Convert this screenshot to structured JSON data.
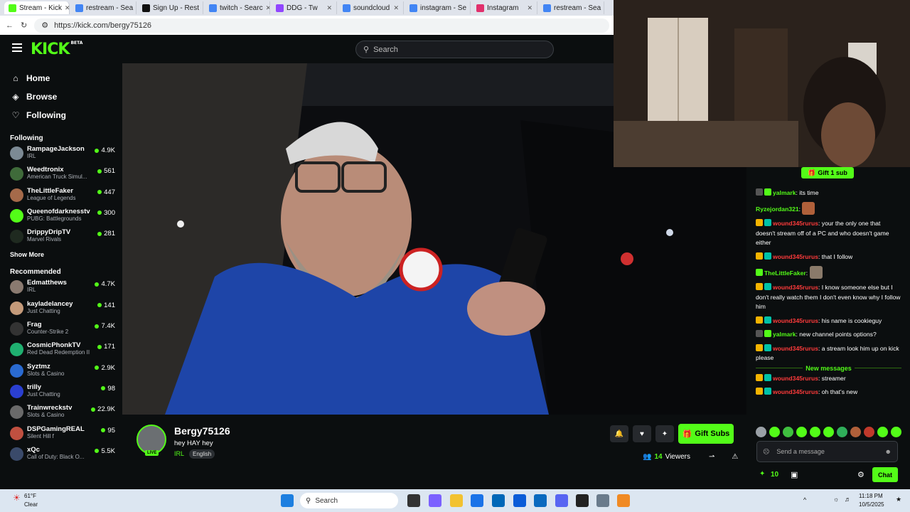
{
  "browser": {
    "tabs": [
      {
        "label": "Stream - Kick",
        "color": "#53fc18"
      },
      {
        "label": "restream - Sea",
        "color": "#4285f4"
      },
      {
        "label": "Sign Up - Rest",
        "color": "#111111"
      },
      {
        "label": "twitch - Searc",
        "color": "#4285f4"
      },
      {
        "label": "DDG - Tw",
        "color": "#9146ff"
      },
      {
        "label": "soundcloud",
        "color": "#4285f4"
      },
      {
        "label": "instagram - Se",
        "color": "#4285f4"
      },
      {
        "label": "Instagram",
        "color": "#e1306c"
      },
      {
        "label": "restream - Sea",
        "color": "#4285f4"
      }
    ],
    "url": "https://kick.com/bergy75126"
  },
  "header": {
    "logo": "KICK",
    "logo_beta": "BETA",
    "search_placeholder": "Search"
  },
  "sidebar": {
    "nav": [
      {
        "label": "Home",
        "icon": "⌂"
      },
      {
        "label": "Browse",
        "icon": "◈"
      },
      {
        "label": "Following",
        "icon": "♡"
      }
    ],
    "following_title": "Following",
    "following": [
      {
        "name": "RampageJackson",
        "category": "IRL",
        "viewers": "4.9K",
        "color": "#7c8a94"
      },
      {
        "name": "Weedtronix",
        "category": "American Truck Simul...",
        "viewers": "561",
        "color": "#3f6b3a"
      },
      {
        "name": "TheLittleFaker",
        "category": "League of Legends",
        "viewers": "447",
        "color": "#a56a4a"
      },
      {
        "name": "Queenofdarknesstv",
        "category": "PUBG: Battlegrounds",
        "viewers": "300",
        "color": "#53fc18"
      },
      {
        "name": "DrippyDripTV",
        "category": "Marvel Rivals",
        "viewers": "281",
        "color": "#1f2a20"
      }
    ],
    "show_more": "Show More",
    "recommended_title": "Recommended",
    "recommended": [
      {
        "name": "Edmatthews",
        "category": "IRL",
        "viewers": "4.7K",
        "color": "#8a7a70"
      },
      {
        "name": "kayladelancey",
        "category": "Just Chatting",
        "viewers": "141",
        "color": "#c49a7a"
      },
      {
        "name": "Frag",
        "category": "Counter-Strike 2",
        "viewers": "7.4K",
        "color": "#333333"
      },
      {
        "name": "CosmicPhonkTV",
        "category": "Red Dead Redemption II",
        "viewers": "171",
        "color": "#1fb070"
      },
      {
        "name": "Syztmz",
        "category": "Slots & Casino",
        "viewers": "2.9K",
        "color": "#2a6ad0"
      },
      {
        "name": "trilly",
        "category": "Just Chatting",
        "viewers": "98",
        "color": "#2a3fd0"
      },
      {
        "name": "Trainwreckstv",
        "category": "Slots & Casino",
        "viewers": "22.9K",
        "color": "#6a6a6a"
      },
      {
        "name": "DSPGamingREAL",
        "category": "Silent Hill f",
        "viewers": "95",
        "color": "#c05040"
      },
      {
        "name": "xQc",
        "category": "Call of Duty: Black O...",
        "viewers": "5.5K",
        "color": "#3a4a6a"
      }
    ]
  },
  "stream": {
    "streamer": "Bergy75126",
    "title": "hey HAY hey",
    "category": "IRL",
    "language": "English",
    "live_badge": "LIVE",
    "gift_subs": "Gift Subs",
    "viewers_count": "14",
    "viewers_label": "Viewers"
  },
  "chat": {
    "gift_sub": "Gift 1 sub",
    "messages": [
      {
        "user": "yalmark",
        "color": "#53fc18",
        "text": ": its time",
        "badges": [
          "#555555",
          "#53fc18"
        ]
      },
      {
        "user": "Ryzejordan321",
        "color": "#53fc18",
        "text": ":",
        "badges": [],
        "emote": "#b0603a"
      },
      {
        "user": "wound345rurus",
        "color": "#ff3b3b",
        "text": ": your the only one that doesn't stream off of a PC and who doesn't game either",
        "badges": [
          "#f5b400",
          "#00c2a8"
        ]
      },
      {
        "user": "wound345rurus",
        "color": "#ff3b3b",
        "text": ": that I follow",
        "badges": [
          "#f5b400",
          "#00c2a8"
        ]
      },
      {
        "user": "TheLittleFaker",
        "color": "#53fc18",
        "text": ":",
        "badges": [
          "#53fc18"
        ],
        "emote": "#8a7a6a"
      },
      {
        "user": "wound345rurus",
        "color": "#ff3b3b",
        "text": ": I know someone else but I don't really watch them I don't even know why I follow him",
        "badges": [
          "#f5b400",
          "#00c2a8"
        ]
      },
      {
        "user": "wound345rurus",
        "color": "#ff3b3b",
        "text": ": his name is cookieguy",
        "badges": [
          "#f5b400",
          "#00c2a8"
        ]
      },
      {
        "user": "yalmark",
        "color": "#53fc18",
        "text": ": new channel points options?",
        "badges": [
          "#555555",
          "#53fc18"
        ]
      },
      {
        "user": "wound345rurus",
        "color": "#ff3b3b",
        "text": ": a stream look him up on kick please",
        "badges": [
          "#f5b400",
          "#00c2a8"
        ]
      }
    ],
    "new_messages": "New messages",
    "new": [
      {
        "user": "wound345rurus",
        "color": "#ff3b3b",
        "text": ": streamer",
        "badges": [
          "#f5b400",
          "#00c2a8"
        ]
      },
      {
        "user": "wound345rurus",
        "color": "#ff3b3b",
        "text": ": oh that's new",
        "badges": [
          "#f5b400",
          "#00c2a8"
        ]
      }
    ],
    "input_placeholder": "Send a message",
    "points": "10",
    "chat_button": "Chat"
  },
  "taskbar": {
    "weather_temp": "61°F",
    "weather_desc": "Clear",
    "search": "Search",
    "time": "11:18 PM",
    "date": "10/5/2025"
  }
}
